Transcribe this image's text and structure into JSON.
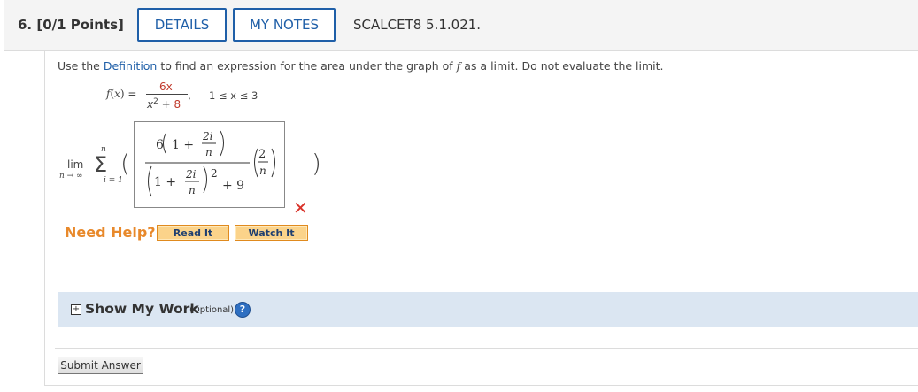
{
  "question": {
    "number": "6.",
    "points": "[0/1 Points]",
    "code": "SCALCET8 5.1.021."
  },
  "header_buttons": {
    "details": "DETAILS",
    "my_notes": "MY NOTES"
  },
  "instruction": {
    "prefix": "Use the ",
    "link": "Definition",
    "rest1": " to find an expression for the area under the graph of ",
    "var": "f",
    "rest2": " as a limit. Do not evaluate the limit."
  },
  "function": {
    "lhs": "f(x) =",
    "numerator": "6x",
    "denominator_base": "x",
    "denominator_exp": "2",
    "denominator_plus": " + ",
    "denominator_const": "8",
    "comma": ",",
    "domain": "1 ≤ x ≤ 3"
  },
  "limit": {
    "lim": "lim",
    "sub": "n → ∞",
    "sigma_top": "n",
    "sigma_bottom": "i = 1"
  },
  "answer": {
    "num_coef": "6",
    "one": "1 +",
    "two_i": "2i",
    "n": "n",
    "exp": "2",
    "plus9": "+ 9",
    "two": "2",
    "status": "incorrect"
  },
  "help": {
    "label": "Need Help?",
    "read_it": "Read It",
    "watch_it": "Watch It"
  },
  "show_work": {
    "label": "Show My Work",
    "optional": "(Optional)",
    "help_icon": "?"
  },
  "submit": {
    "label": "Submit Answer"
  },
  "colors": {
    "accent": "#1f5fa8",
    "help_orange": "#e8892b",
    "error_red": "#d9342b",
    "show_work_bg": "#dbe6f2"
  }
}
